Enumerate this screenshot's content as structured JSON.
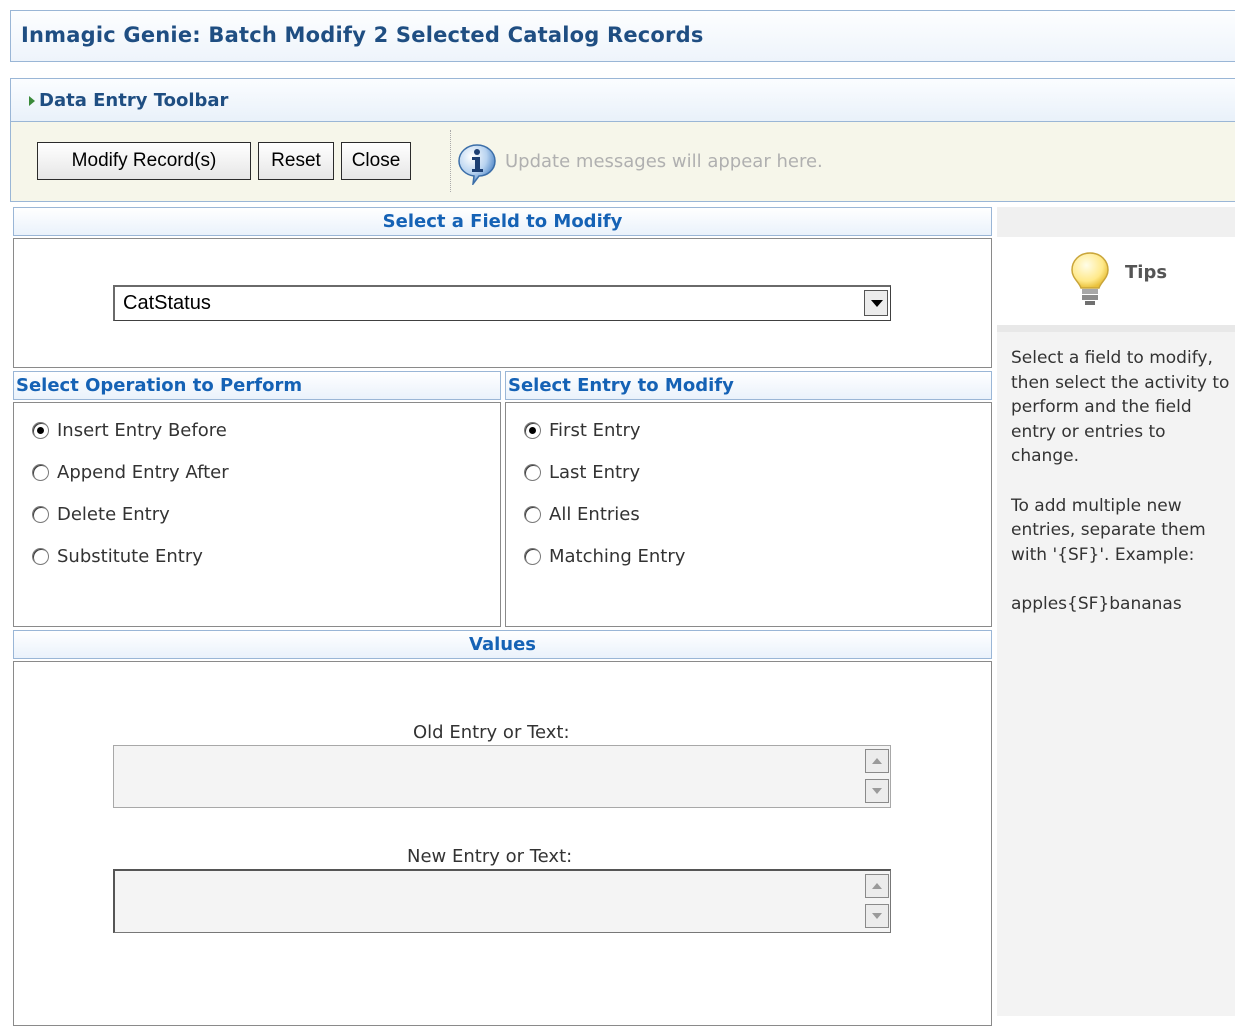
{
  "window": {
    "title": "Inmagic Genie: Batch Modify 2 Selected Catalog Records"
  },
  "toolbar": {
    "title": "Data Entry Toolbar",
    "buttons": {
      "modify": "Modify Record(s)",
      "reset": "Reset",
      "close": "Close"
    },
    "message": "Update messages will appear here."
  },
  "field_panel": {
    "title": "Select a Field to Modify",
    "selected_field": "CatStatus"
  },
  "operation_panel": {
    "title": "Select Operation to Perform",
    "options": [
      "Insert Entry Before",
      "Append Entry After",
      "Delete Entry",
      "Substitute Entry"
    ],
    "selected": "Insert Entry Before"
  },
  "entry_panel": {
    "title": "Select Entry to Modify",
    "options": [
      "First Entry",
      "Last Entry",
      "All Entries",
      "Matching Entry"
    ],
    "selected": "First Entry"
  },
  "values_panel": {
    "title": "Values",
    "old_label": "Old Entry or Text:",
    "new_label": "New Entry or Text:",
    "old_value": "",
    "new_value": ""
  },
  "tips": {
    "title": "Tips",
    "paragraphs": [
      "Select a field to modify, then select the activity to perform and the field entry or entries to change.",
      "To add multiple new entries, separate them with '{SF}'. Example:",
      "apples{SF}bananas"
    ]
  },
  "colors": {
    "heading": "#1f4e82",
    "panel_heading": "#1562b5",
    "toolbar_bg": "#f6f6ea",
    "border": "#9ab6d6"
  },
  "icons": {
    "toolbar_arrow": "triangle-right-icon",
    "info": "info-icon",
    "tips": "lightbulb-icon"
  }
}
